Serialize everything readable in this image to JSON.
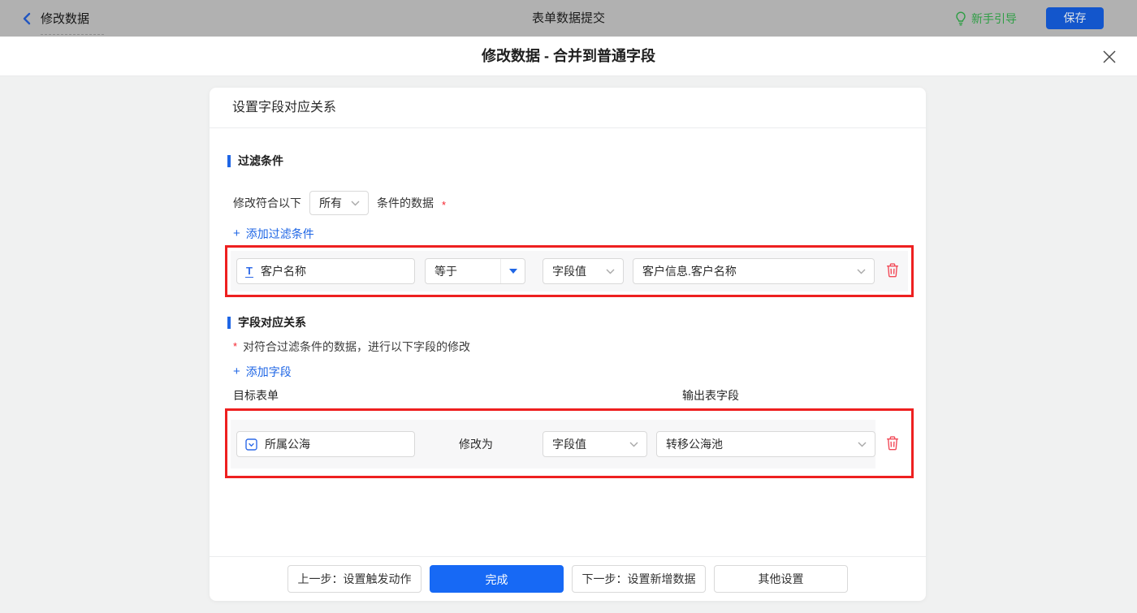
{
  "ui": {
    "plus": "+",
    "required_mark": "*"
  },
  "colors": {
    "accent_blue": "#1769f5",
    "link_blue": "#1f66e5",
    "highlight_red": "#ee2020",
    "danger_red": "#f24957",
    "guide_green": "#2f9e45",
    "topbar_dim_gray": "#b1b1b1"
  },
  "topbar": {
    "back_label": "修改数据",
    "title": "表单数据提交",
    "guide_label": "新手引导",
    "save_label": "保存"
  },
  "modal": {
    "title": "修改数据 - 合并到普通字段",
    "card_header": "设置字段对应关系",
    "filter": {
      "section_title": "过滤条件",
      "prefix": "修改符合以下",
      "match_value": "所有",
      "suffix": "条件的数据",
      "add_link": "添加过滤条件",
      "row": {
        "field": "客户名称",
        "field_icon": "text-field",
        "operator": "等于",
        "value_type": "字段值",
        "value": "客户信息.客户名称"
      }
    },
    "mapping": {
      "section_title": "字段对应关系",
      "note": "对符合过滤条件的数据，进行以下字段的修改",
      "add_link": "添加字段",
      "col_target": "目标表单",
      "col_output": "输出表字段",
      "row": {
        "field": "所属公海",
        "field_icon": "select-field",
        "action": "修改为",
        "value_type": "字段值",
        "value": "转移公海池"
      }
    },
    "footer": {
      "prev": "上一步：设置触发动作",
      "done": "完成",
      "next": "下一步：设置新增数据",
      "other": "其他设置"
    }
  }
}
